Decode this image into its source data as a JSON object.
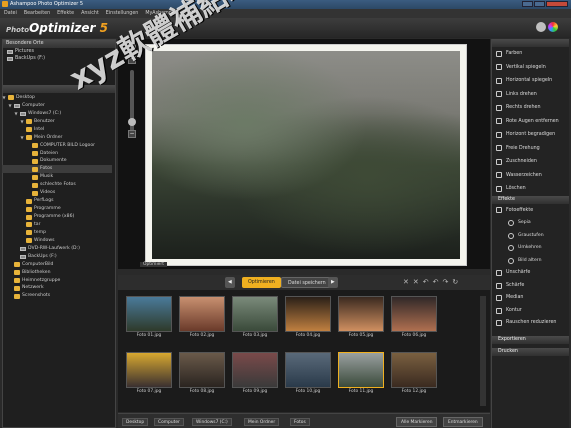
{
  "window": {
    "title": "Ashampoo Photo Optimizer 5"
  },
  "menu": [
    "Datei",
    "Bearbeiten",
    "Effekte",
    "Ansicht",
    "Einstellungen",
    "MyAshampoo",
    "Hilfe"
  ],
  "logo": {
    "photo": "Photo",
    "optimizer": "Optimizer",
    "version": "5"
  },
  "left": {
    "recent_header": "Besondere Orte",
    "recent": [
      "Pictures",
      "BackUps (F:)"
    ],
    "tree": [
      {
        "label": "Desktop",
        "indent": 0,
        "tw": "▼",
        "icon": "fold"
      },
      {
        "label": "Computer",
        "indent": 1,
        "tw": "▼",
        "icon": "drv"
      },
      {
        "label": "Windows7 (C:)",
        "indent": 2,
        "tw": "▼",
        "icon": "drv"
      },
      {
        "label": "Benutzer",
        "indent": 3,
        "tw": "▼",
        "icon": "fold"
      },
      {
        "label": "Intel",
        "indent": 3,
        "tw": "",
        "icon": "fold"
      },
      {
        "label": "Mein Ordner",
        "indent": 3,
        "tw": "▼",
        "icon": "fold"
      },
      {
        "label": "COMPUTER BILD Logoor",
        "indent": 4,
        "tw": "",
        "icon": "fold"
      },
      {
        "label": "Dateien",
        "indent": 4,
        "tw": "",
        "icon": "fold"
      },
      {
        "label": "Dokumente",
        "indent": 4,
        "tw": "",
        "icon": "fold"
      },
      {
        "label": "Fotos",
        "indent": 4,
        "tw": "",
        "icon": "fold",
        "sel": true
      },
      {
        "label": "Musik",
        "indent": 4,
        "tw": "",
        "icon": "fold"
      },
      {
        "label": "schlechte Fotos",
        "indent": 4,
        "tw": "",
        "icon": "fold"
      },
      {
        "label": "Videos",
        "indent": 4,
        "tw": "",
        "icon": "fold"
      },
      {
        "label": "PerfLogs",
        "indent": 3,
        "tw": "",
        "icon": "fold"
      },
      {
        "label": "Programme",
        "indent": 3,
        "tw": "",
        "icon": "fold"
      },
      {
        "label": "Programme (x86)",
        "indent": 3,
        "tw": "",
        "icon": "fold"
      },
      {
        "label": "tar",
        "indent": 3,
        "tw": "",
        "icon": "fold"
      },
      {
        "label": "temp",
        "indent": 3,
        "tw": "",
        "icon": "fold"
      },
      {
        "label": "Windows",
        "indent": 3,
        "tw": "",
        "icon": "fold"
      },
      {
        "label": "DVD-RW-Laufwerk (D:)",
        "indent": 2,
        "tw": "",
        "icon": "drv"
      },
      {
        "label": "BackUps (F:)",
        "indent": 2,
        "tw": "",
        "icon": "drv"
      },
      {
        "label": "ComputerBild",
        "indent": 1,
        "tw": "",
        "icon": "fold"
      },
      {
        "label": "Bibliotheken",
        "indent": 1,
        "tw": "",
        "icon": "fold"
      },
      {
        "label": "Heimnetzgruppe",
        "indent": 1,
        "tw": "",
        "icon": "fold"
      },
      {
        "label": "Netzwerk",
        "indent": 1,
        "tw": "",
        "icon": "fold"
      },
      {
        "label": "Screenshots",
        "indent": 1,
        "tw": "",
        "icon": "fold"
      }
    ]
  },
  "preview": {
    "label": "Optimiert"
  },
  "toolbar": {
    "optimize": "Optimieren",
    "save": "Datei speichern"
  },
  "thumbs": [
    {
      "cap": "Foto 01.jpg",
      "c1": "#4a7a9a",
      "c2": "#2e3a2a"
    },
    {
      "cap": "Foto 02.jpg",
      "c1": "#c89070",
      "c2": "#6a3a2a"
    },
    {
      "cap": "Foto 03.jpg",
      "c1": "#7a8a7a",
      "c2": "#3a4a3a"
    },
    {
      "cap": "Foto 04.jpg",
      "c1": "#2a2018",
      "c2": "#c08040"
    },
    {
      "cap": "Foto 05.jpg",
      "c1": "#3a2a20",
      "c2": "#d09060"
    },
    {
      "cap": "Foto 06.jpg",
      "c1": "#302828",
      "c2": "#b07050"
    },
    {
      "cap": "Foto 07.jpg",
      "c1": "#d8a830",
      "c2": "#3a3030"
    },
    {
      "cap": "Foto 08.jpg",
      "c1": "#6a5a4a",
      "c2": "#2a2420"
    },
    {
      "cap": "Foto 09.jpg",
      "c1": "#7a4a4a",
      "c2": "#3a3a3a"
    },
    {
      "cap": "Foto 10.jpg",
      "c1": "#5a6a7a",
      "c2": "#2a3a4a"
    },
    {
      "cap": "Foto 11.jpg",
      "c1": "#9aa0a0",
      "c2": "#3a4a3a",
      "sel": true
    },
    {
      "cap": "Foto 12.jpg",
      "c1": "#7a6040",
      "c2": "#3a2a20"
    }
  ],
  "right": {
    "items": [
      "Farben",
      "Vertikal spiegeln",
      "Horizontal spiegeln",
      "Links drehen",
      "Rechts drehen",
      "Rote Augen entfernen",
      "Horizont begradigen",
      "Freie Drehung",
      "Zuschneiden",
      "Wasserzeichen",
      "Löschen"
    ],
    "effects_header": "Effekte",
    "effects_group": "Fotoeffekte",
    "effects": [
      "Sepia",
      "Graustufen",
      "Umkehren",
      "Bild altern"
    ],
    "more": [
      "Unschärfe",
      "Schärfe",
      "Median",
      "Kontur",
      "Rauschen reduzieren"
    ],
    "export": "Exportieren",
    "print": "Drucken"
  },
  "status": {
    "crumbs": [
      "Desktop",
      "Computer",
      "Windows7 (C:)",
      "Mein Ordner",
      "Fotos"
    ],
    "select_all": "Alle Markieren",
    "deselect": "Entmarkieren"
  },
  "watermark": "xyz軟體補給站 http://31.to"
}
